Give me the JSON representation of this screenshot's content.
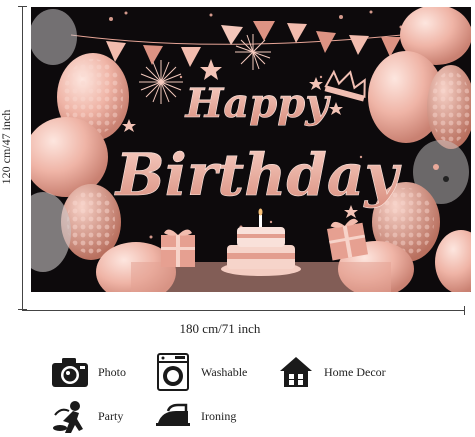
{
  "banner": {
    "headline_line1": "Happy",
    "headline_line2": "Birthday",
    "colors": {
      "background": "#0d0a0c",
      "rose_gold": "#e8a79a",
      "pink_light": "#f4c7bd"
    }
  },
  "dimensions": {
    "height_label": "120 cm/47 inch",
    "width_label": "180 cm/71 inch"
  },
  "features": [
    {
      "icon": "camera-icon",
      "label": "Photo"
    },
    {
      "icon": "washing-machine-icon",
      "label": "Washable"
    },
    {
      "icon": "house-icon",
      "label": "Home Decor"
    },
    {
      "icon": "party-icon",
      "label": "Party"
    },
    {
      "icon": "iron-icon",
      "label": "Ironing"
    }
  ]
}
